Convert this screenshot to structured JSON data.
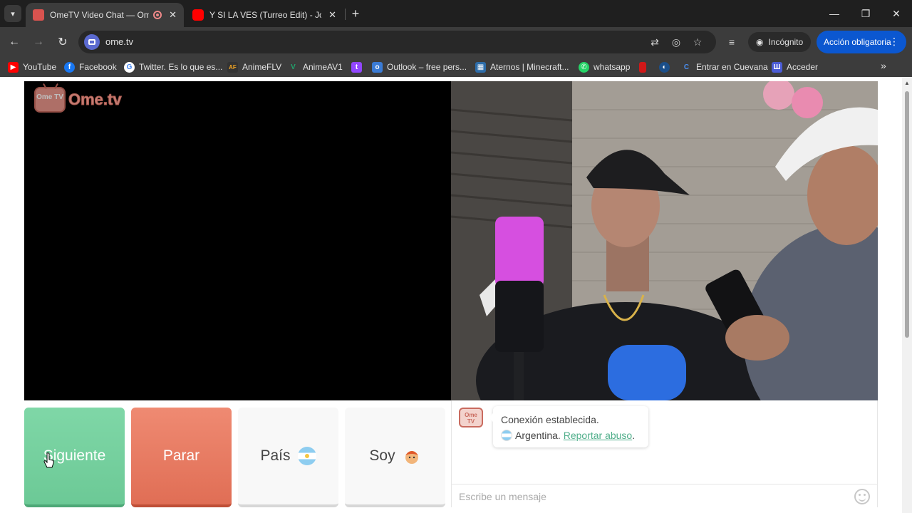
{
  "browser": {
    "tabs": [
      {
        "title": "OmeTV Video Chat — Ome",
        "active": true,
        "favicon_color": "#d9534f"
      },
      {
        "title": "Y SI LA VES (Turreo Edit) - Jona",
        "active": false,
        "favicon_color": "#ff0000"
      }
    ],
    "url": "ome.tv",
    "incognito_label": "Incógnito",
    "action_label": "Acción obligatoria"
  },
  "bookmarks": [
    {
      "label": "YouTube",
      "icon": "youtube-icon",
      "color": "#ff0000"
    },
    {
      "label": "Facebook",
      "icon": "facebook-icon",
      "color": "#1877f2"
    },
    {
      "label": "Twitter. Es lo que es...",
      "icon": "google-icon",
      "color": "#ffffff"
    },
    {
      "label": "AnimeFLV",
      "icon": "animeflv-icon",
      "color": "#333333"
    },
    {
      "label": "AnimeAV1",
      "icon": "animeav1-icon",
      "color": "#22a06b"
    },
    {
      "label": "",
      "icon": "twitch-icon",
      "color": "#9146ff"
    },
    {
      "label": "Outlook – free pers...",
      "icon": "outlook-icon",
      "color": "#3a7bd5"
    },
    {
      "label": "Aternos | Minecraft...",
      "icon": "aternos-icon",
      "color": "#2d6ca8"
    },
    {
      "label": "whatsapp",
      "icon": "whatsapp-icon",
      "color": "#25d366"
    },
    {
      "label": "",
      "icon": "red-bookmark-icon",
      "color": "#d01818"
    },
    {
      "label": "",
      "icon": "steam-icon",
      "color": "#1b4f8a"
    },
    {
      "label": "Entrar en Cuevana",
      "icon": "cuevana-icon",
      "color": "#1a56c4"
    },
    {
      "label": "Acceder",
      "icon": "acceder-icon",
      "color": "#4b5cd6"
    }
  ],
  "page": {
    "logo_text": "Ome.tv",
    "logo_box_text": "Ome TV",
    "buttons": {
      "next": "Siguiente",
      "stop": "Parar",
      "country": "País",
      "soy": "Soy"
    },
    "chat": {
      "status": "Conexión establecida.",
      "country": "Argentina.",
      "report": "Reportar abuso",
      "report_suffix": ".",
      "input_placeholder": "Escribe un mensaje"
    }
  }
}
